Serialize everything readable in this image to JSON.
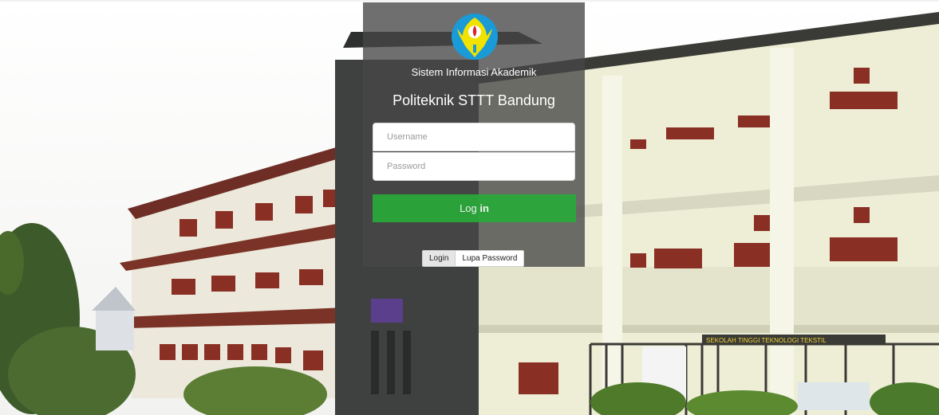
{
  "subtitle": "Sistem Informasi Akademik",
  "title": "Politeknik STTT Bandung",
  "form": {
    "username_placeholder": "Username",
    "password_placeholder": "Password",
    "login_label_prefix": "Log ",
    "login_label_bold": "in"
  },
  "tabs": {
    "login": "Login",
    "forgot": "Lupa Password"
  },
  "background": {
    "sign_text": "SEKOLAH TINGGI TEKNOLOGI TEKSTIL"
  },
  "colors": {
    "login_button": "#29a93a",
    "panel": "#464646",
    "logo_blue": "#1a9ad6",
    "logo_yellow": "#f2e200"
  }
}
